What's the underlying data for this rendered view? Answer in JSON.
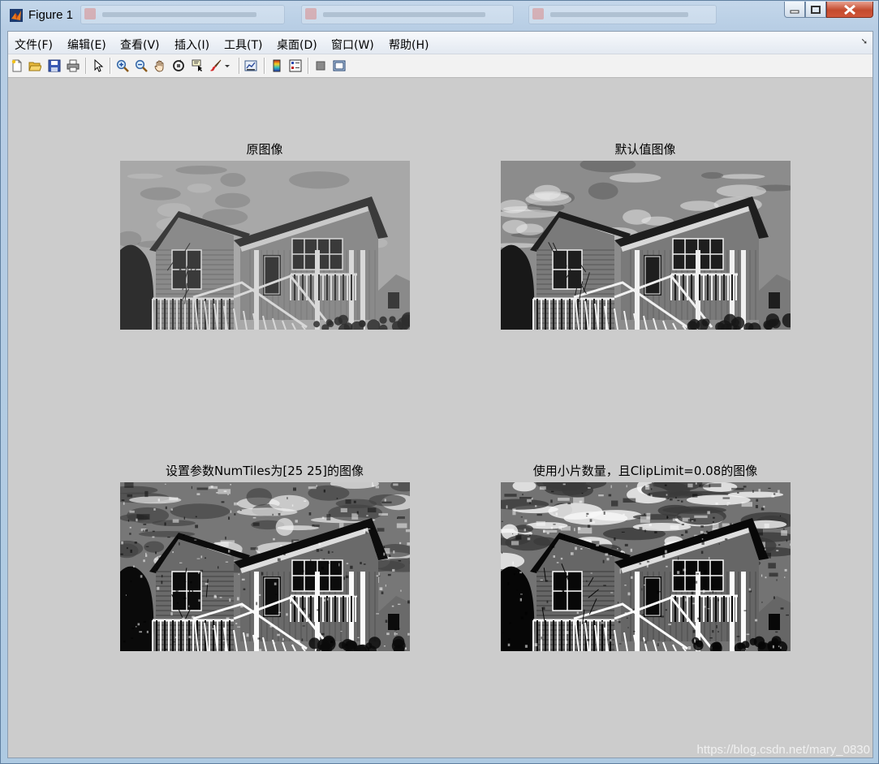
{
  "window": {
    "title": "Figure 1"
  },
  "menubar": {
    "items": [
      {
        "label": "文件(F)"
      },
      {
        "label": "编辑(E)"
      },
      {
        "label": "查看(V)"
      },
      {
        "label": "插入(I)"
      },
      {
        "label": "工具(T)"
      },
      {
        "label": "桌面(D)"
      },
      {
        "label": "窗口(W)"
      },
      {
        "label": "帮助(H)"
      }
    ]
  },
  "toolbar": {
    "icons": [
      "new-figure-icon",
      "open-file-icon",
      "save-icon",
      "print-icon",
      "edit-plot-arrow-icon",
      "zoom-in-icon",
      "zoom-out-icon",
      "pan-hand-icon",
      "rotate-3d-icon",
      "data-cursor-icon",
      "brush-icon",
      "link-plot-icon",
      "colorbar-icon",
      "legend-icon",
      "hide-plot-tools-icon",
      "show-plot-tools-icon"
    ]
  },
  "figure": {
    "subplots": [
      {
        "title": "原图像",
        "style": "original"
      },
      {
        "title": "默认值图像",
        "style": "default"
      },
      {
        "title": "设置参数NumTiles为[25 25]的图像",
        "style": "tiles"
      },
      {
        "title": "使用小片数量，且ClipLimit=0.08的图像",
        "style": "clip"
      }
    ]
  },
  "watermark": "https://blog.csdn.net/mary_0830"
}
